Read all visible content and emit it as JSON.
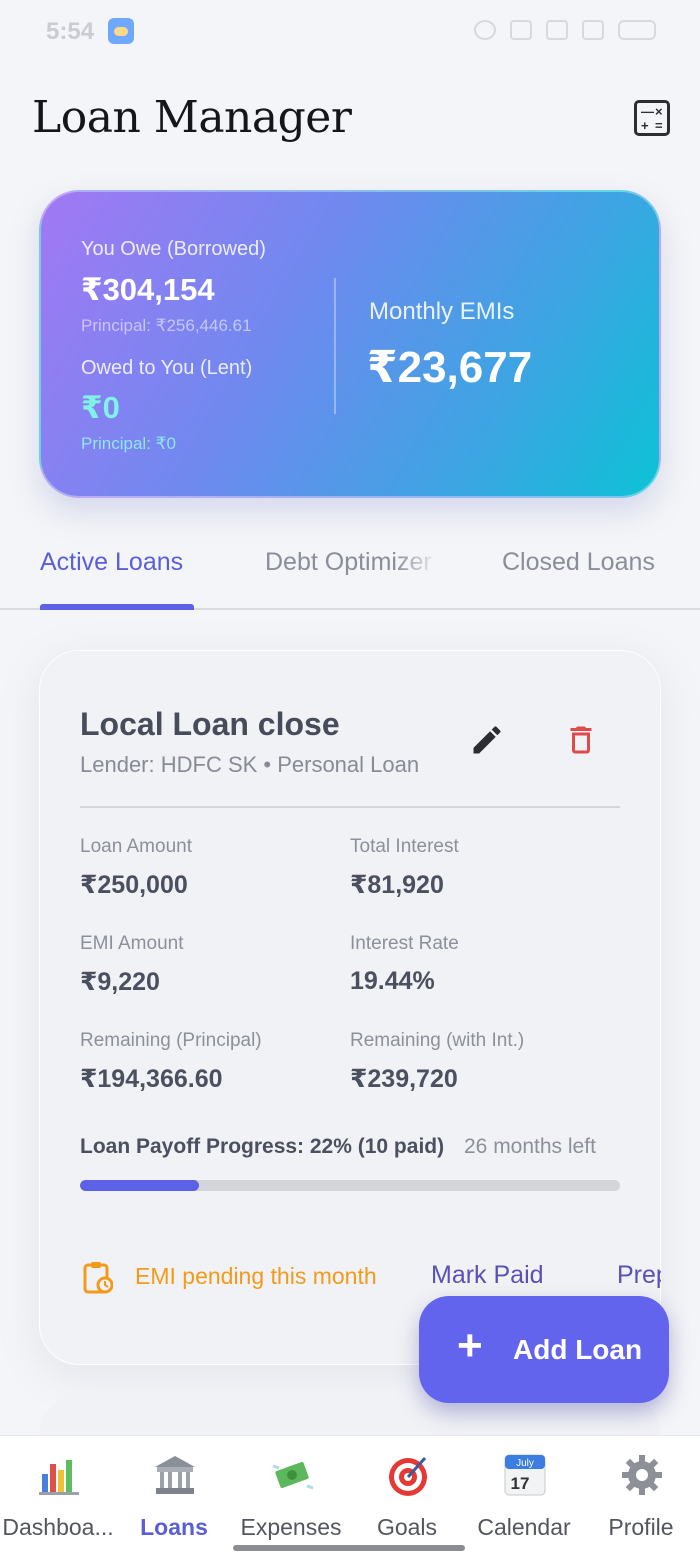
{
  "status_bar": {
    "time": "5:54"
  },
  "header": {
    "title": "Loan Manager",
    "calculator_icon": "calculator-icon"
  },
  "summary": {
    "borrowed_label": "You Owe (Borrowed)",
    "borrowed_value": "₹304,154",
    "borrowed_principal": "Principal: ₹256,446.61",
    "lent_label": "Owed to You (Lent)",
    "lent_value": "₹0",
    "lent_principal": "Principal: ₹0",
    "emi_label": "Monthly EMIs",
    "emi_value": "₹23,677"
  },
  "tabs": [
    {
      "label": "Active Loans",
      "active": true
    },
    {
      "label": "Debt Optimizer",
      "active": false
    },
    {
      "label": "Closed Loans",
      "active": false
    }
  ],
  "loan": {
    "title": "Local Loan close",
    "subtitle": "Lender: HDFC SK • Personal Loan",
    "fields": {
      "loan_amount_label": "Loan Amount",
      "loan_amount_value": "₹250,000",
      "total_interest_label": "Total Interest",
      "total_interest_value": "₹81,920",
      "emi_amount_label": "EMI Amount",
      "emi_amount_value": "₹9,220",
      "interest_rate_label": "Interest Rate",
      "interest_rate_value": "19.44%",
      "remaining_principal_label": "Remaining (Principal)",
      "remaining_principal_value": "₹194,366.60",
      "remaining_int_label": "Remaining (with Int.)",
      "remaining_int_value": "₹239,720"
    },
    "progress_label": "Loan Payoff Progress: 22% (10 paid)",
    "progress_left": "26 months left",
    "progress_fraction": 0.22,
    "pending_text": "EMI pending this month",
    "mark_paid_label": "Mark Paid",
    "prepay_label": "Prepay"
  },
  "fab": {
    "label": "Add Loan"
  },
  "bottom_nav": [
    {
      "label": "Dashboa...",
      "icon": "bar-chart-icon"
    },
    {
      "label": "Loans",
      "icon": "bank-icon",
      "active": true
    },
    {
      "label": "Expenses",
      "icon": "money-icon"
    },
    {
      "label": "Goals",
      "icon": "target-icon"
    },
    {
      "label": "Calendar",
      "icon": "calendar-icon",
      "month": "July",
      "day": "17"
    },
    {
      "label": "Profile",
      "icon": "gear-icon"
    }
  ],
  "colors": {
    "accent": "#5d61e6",
    "pending": "#f39a1b",
    "delete": "#e04a4a"
  }
}
